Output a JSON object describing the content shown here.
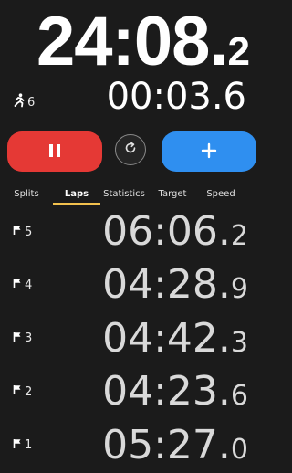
{
  "main": {
    "time": "24:08.",
    "tenths": "2"
  },
  "runner": {
    "count": "6",
    "icon": "runner-icon"
  },
  "current_lap": {
    "time": "00:03.6"
  },
  "controls": {
    "pause_icon": "pause-icon",
    "reset_icon": "reset-icon",
    "add_icon": "plus-icon"
  },
  "tabs": [
    {
      "label": "Splits"
    },
    {
      "label": "Laps"
    },
    {
      "label": "Statistics"
    },
    {
      "label": "Target"
    },
    {
      "label": "Speed"
    }
  ],
  "active_tab": "Laps",
  "laps": [
    {
      "number": "5",
      "time": "06:06.",
      "tenths": "2"
    },
    {
      "number": "4",
      "time": "04:28.",
      "tenths": "9"
    },
    {
      "number": "3",
      "time": "04:42.",
      "tenths": "3"
    },
    {
      "number": "2",
      "time": "04:23.",
      "tenths": "6"
    },
    {
      "number": "1",
      "time": "05:27.",
      "tenths": "0"
    }
  ],
  "colors": {
    "background": "#1b1b1b",
    "pause": "#e53935",
    "add": "#2f8ff0",
    "tab_accent": "#f2c14e"
  }
}
